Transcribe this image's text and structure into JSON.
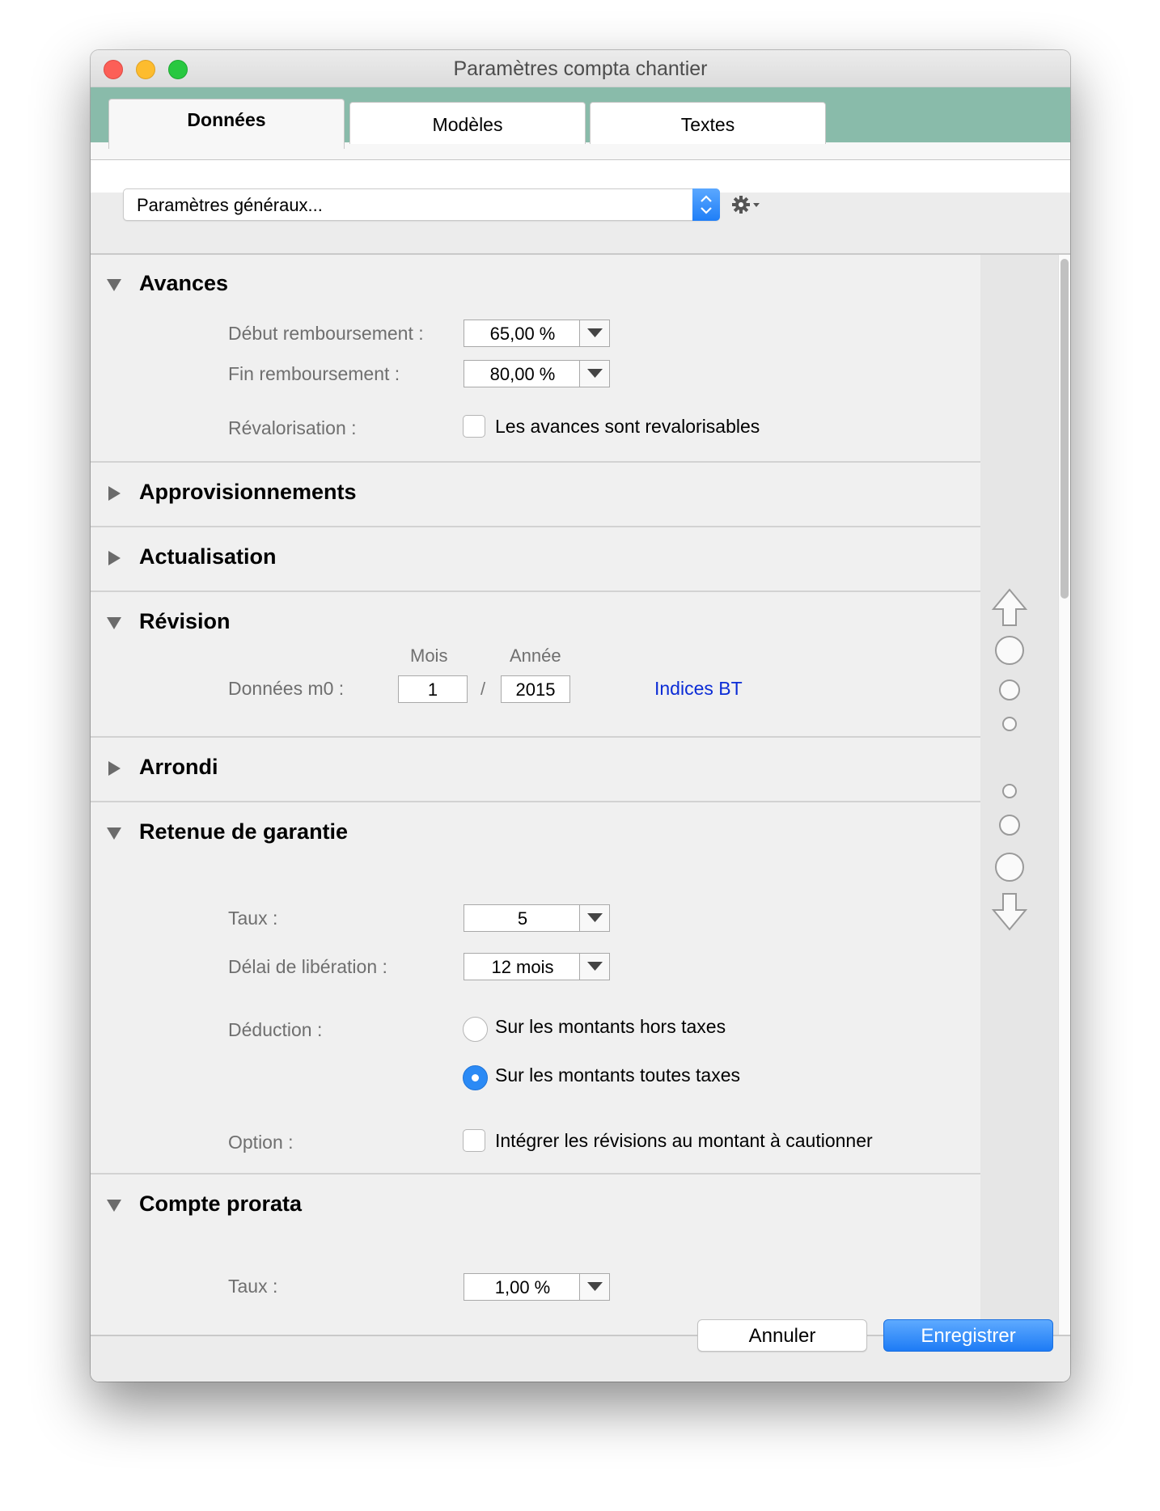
{
  "window": {
    "title": "Paramètres compta chantier"
  },
  "tabs": [
    {
      "label": "Données",
      "active": true
    },
    {
      "label": "Modèles",
      "active": false
    },
    {
      "label": "Textes",
      "active": false
    }
  ],
  "selector": {
    "value": "Paramètres généraux..."
  },
  "icons": {
    "gear": "gear-icon",
    "up_arrow": "arrow-up-icon",
    "down_arrow": "arrow-down-icon"
  },
  "sections": {
    "avances": {
      "title": "Avances",
      "expanded": true,
      "debut_label": "Début remboursement :",
      "debut_value": "65,00 %",
      "fin_label": "Fin remboursement :",
      "fin_value": "80,00 %",
      "reval_label": "Révalorisation :",
      "reval_checkbox_label": "Les avances sont revalorisables",
      "reval_checked": false
    },
    "approvisionnements": {
      "title": "Approvisionnements",
      "expanded": false
    },
    "actualisation": {
      "title": "Actualisation",
      "expanded": false
    },
    "revision": {
      "title": "Révision",
      "expanded": true,
      "col_mois": "Mois",
      "col_annee": "Année",
      "donnees_label": "Données m0 :",
      "mois_value": "1",
      "separator": "/",
      "annee_value": "2015",
      "indices_link": "Indices BT"
    },
    "arrondi": {
      "title": "Arrondi",
      "expanded": false
    },
    "retenue": {
      "title": "Retenue de garantie",
      "expanded": true,
      "taux_label": "Taux :",
      "taux_value": "5",
      "delai_label": "Délai de libération :",
      "delai_value": "12 mois",
      "deduction_label": "Déduction :",
      "deduction_ht": "Sur les montants hors taxes",
      "deduction_ttc": "Sur les montants toutes taxes",
      "deduction_selected": "ttc",
      "option_label": "Option :",
      "option_checkbox_label": "Intégrer les révisions au montant à cautionner",
      "option_checked": false
    },
    "prorata": {
      "title": "Compte prorata",
      "expanded": true,
      "taux_label": "Taux :",
      "taux_value": "1,00 %"
    }
  },
  "footer": {
    "cancel_label": "Annuler",
    "save_label": "Enregistrer"
  },
  "colors": {
    "tab_strip": "#89bbaa",
    "accent": "#2b8af5",
    "link": "#0b2cd6"
  }
}
